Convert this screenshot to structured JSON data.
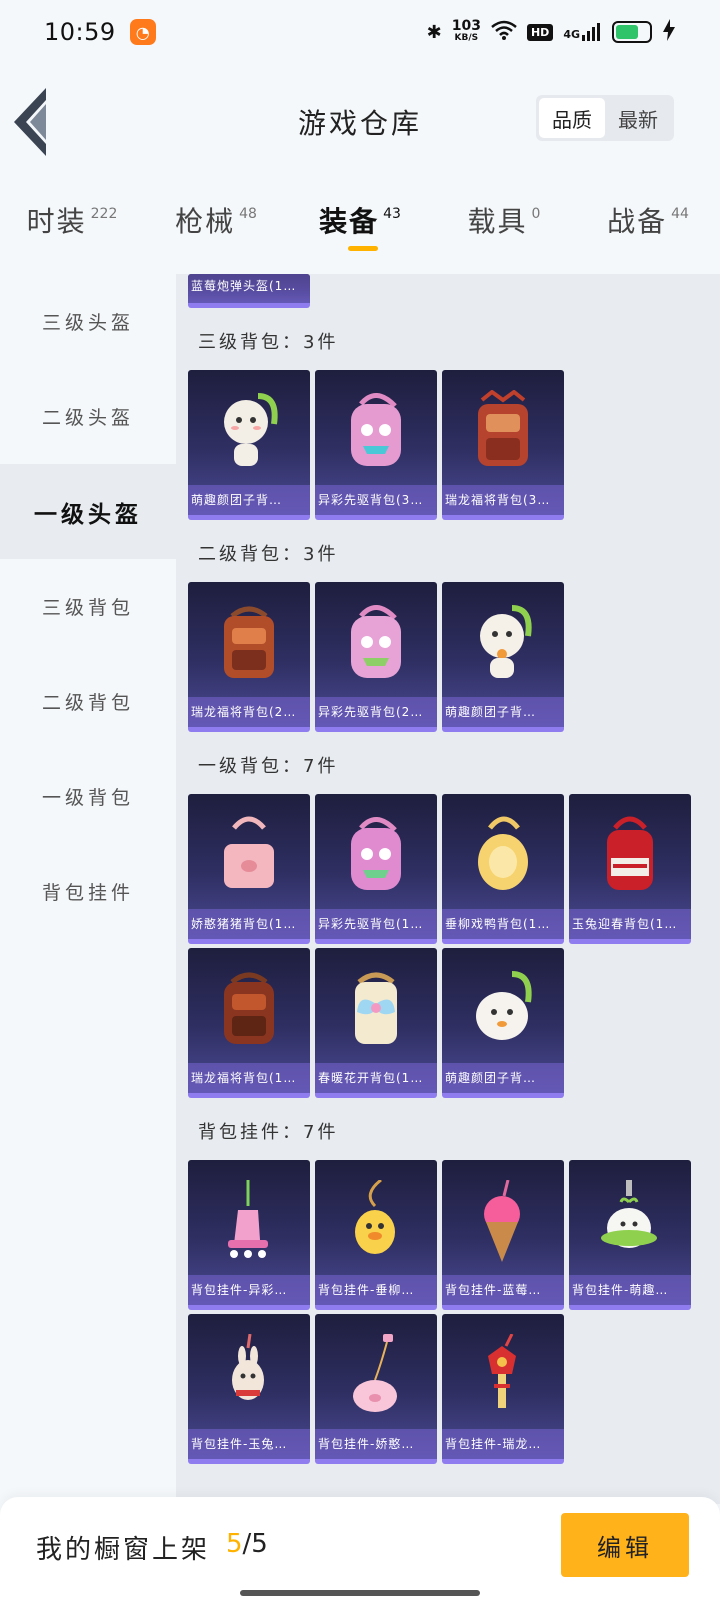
{
  "status": {
    "time": "10:59",
    "net_speed_value": "103",
    "net_speed_unit": "KB/S",
    "hd": "HD",
    "signal": "4G",
    "icons": [
      "app-icon",
      "bluetooth-icon",
      "wifi-icon",
      "signal-icon",
      "battery-icon",
      "charging-icon"
    ]
  },
  "header": {
    "title": "游戏仓库",
    "sort_options": [
      "品质",
      "最新"
    ],
    "sort_active": "品质"
  },
  "categories": [
    {
      "label": "时装",
      "count": "222"
    },
    {
      "label": "枪械",
      "count": "48"
    },
    {
      "label": "装备",
      "count": "43",
      "active": true
    },
    {
      "label": "载具",
      "count": "0"
    },
    {
      "label": "战备",
      "count": "44"
    }
  ],
  "sidebar": {
    "items": [
      "三级头盔",
      "二级头盔",
      "一级头盔",
      "三级背包",
      "二级背包",
      "一级背包",
      "背包挂件"
    ],
    "active": "一级头盔"
  },
  "sections": [
    {
      "title": "",
      "items": [
        "蓝莓炮弹头盔(1…"
      ]
    },
    {
      "title": "三级背包：3件",
      "items": [
        "萌趣颜团子背…",
        "异彩先驱背包(3…",
        "瑞龙福将背包(3…"
      ]
    },
    {
      "title": "二级背包：3件",
      "items": [
        "瑞龙福将背包(2…",
        "异彩先驱背包(2…",
        "萌趣颜团子背…"
      ]
    },
    {
      "title": "一级背包：7件",
      "items": [
        "娇憨猪猪背包(1…",
        "异彩先驱背包(1…",
        "垂柳戏鸭背包(1…",
        "玉兔迎春背包(1…",
        "瑞龙福将背包(1…",
        "春暖花开背包(1…",
        "萌趣颜团子背…"
      ]
    },
    {
      "title": "背包挂件：7件",
      "items": [
        "背包挂件-异彩…",
        "背包挂件-垂柳…",
        "背包挂件-蓝莓…",
        "背包挂件-萌趣…",
        "背包挂件-玉兔…",
        "背包挂件-娇憨…",
        "背包挂件-瑞龙…"
      ]
    }
  ],
  "bottom": {
    "label": "我的橱窗上架",
    "count_current": "5",
    "count_total": "/5",
    "edit_label": "编辑"
  },
  "colors": {
    "accent": "#ffb300",
    "card_top": "#1e1e3e",
    "card_bottom": "#4c4a94"
  }
}
